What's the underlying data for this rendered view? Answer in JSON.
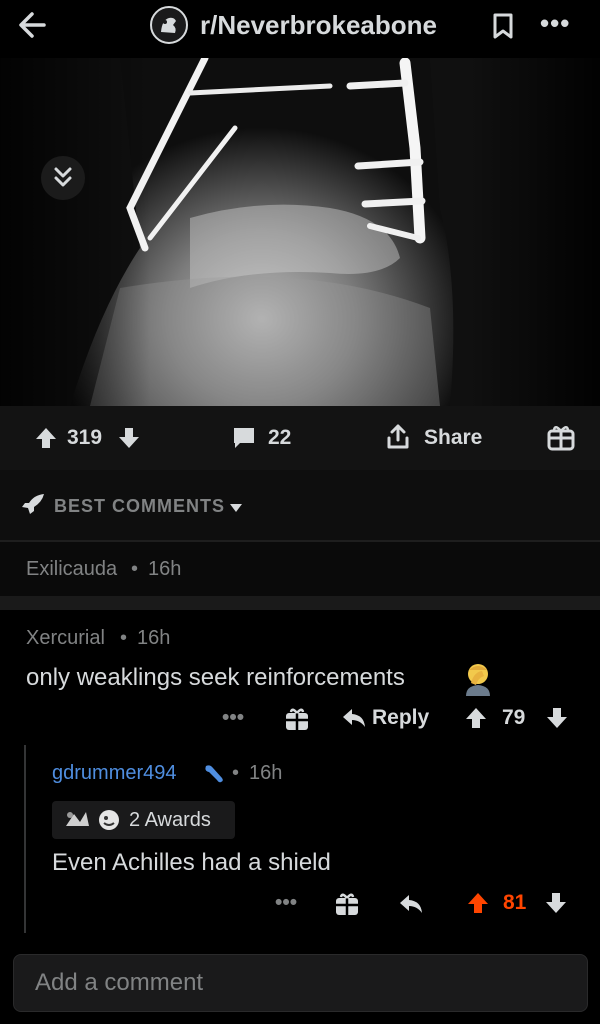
{
  "header": {
    "subreddit": "r/Neverbrokeabone",
    "back_icon": "back-arrow-icon",
    "bookmark_icon": "bookmark-icon",
    "more_icon": "more-dots-icon"
  },
  "post": {
    "upvotes": "319",
    "comments_count": "22",
    "share_label": "Share"
  },
  "sort": {
    "label": "BEST COMMENTS"
  },
  "comments": [
    {
      "author": "Exilicauda",
      "age": "16h",
      "collapsed": true
    },
    {
      "author": "Xercurial",
      "age": "16h",
      "body": "only weaklings seek reinforcements",
      "reply_label": "Reply",
      "score": "79"
    },
    {
      "author": "gdrummer494",
      "age": "16h",
      "awards": "2 Awards",
      "body": "Even Achilles had a shield",
      "score": "81"
    }
  ],
  "composer": {
    "placeholder": "Add a comment"
  },
  "colors": {
    "background": "#000000",
    "text": "#d7dadc",
    "muted": "#818384",
    "username_blue": "#4f8ee0",
    "upvoted_orange": "#ff4500"
  }
}
